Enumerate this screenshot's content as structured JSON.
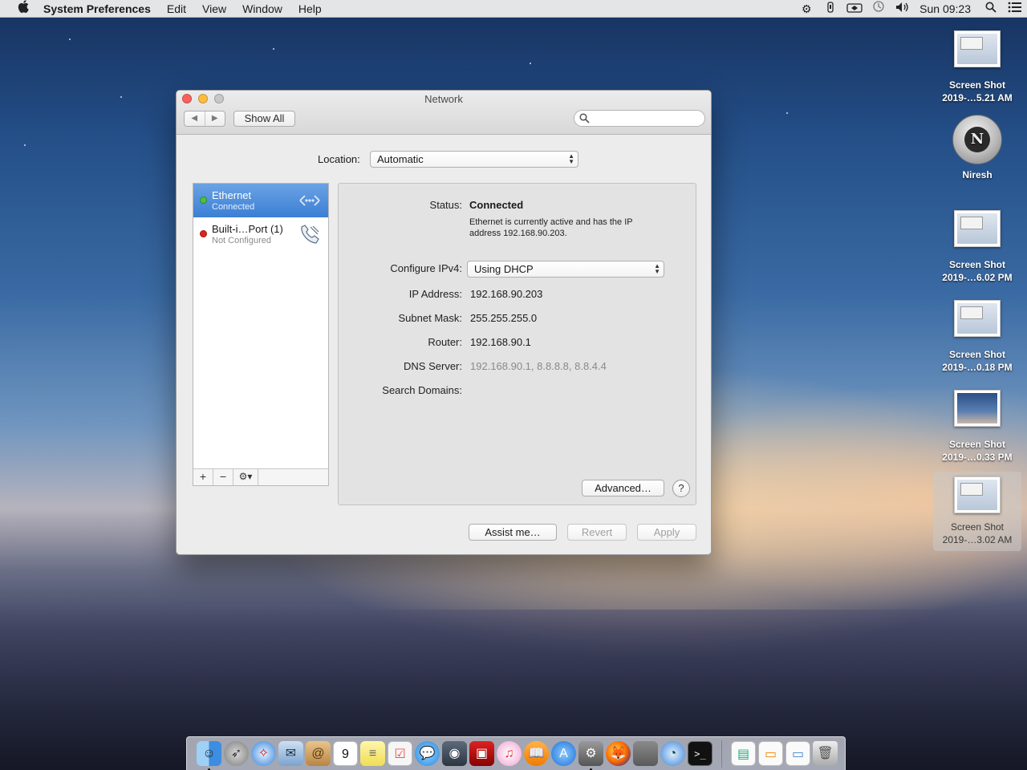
{
  "menubar": {
    "app_name": "System Preferences",
    "items": [
      "Edit",
      "View",
      "Window",
      "Help"
    ],
    "clock": "Sun 09:23"
  },
  "window": {
    "title": "Network",
    "show_all": "Show All",
    "search_placeholder": "",
    "location_label": "Location:",
    "location_value": "Automatic"
  },
  "services": [
    {
      "name": "Ethernet",
      "status": "Connected",
      "state_color": "#4cc43a"
    },
    {
      "name": "Built-i…Port (1)",
      "status": "Not Configured",
      "state_color": "#e0221c"
    }
  ],
  "list_footer": {
    "add": "+",
    "remove": "−",
    "gear": "⚙▾"
  },
  "detail": {
    "status_label": "Status:",
    "status_value": "Connected",
    "status_description": "Ethernet is currently active and has the IP address 192.168.90.203.",
    "configure_label": "Configure IPv4:",
    "configure_value": "Using DHCP",
    "ip_label": "IP Address:",
    "ip_value": "192.168.90.203",
    "subnet_label": "Subnet Mask:",
    "subnet_value": "255.255.255.0",
    "router_label": "Router:",
    "router_value": "192.168.90.1",
    "dns_label": "DNS Server:",
    "dns_value": "192.168.90.1, 8.8.8.8, 8.8.4.4",
    "search_domains_label": "Search Domains:",
    "search_domains_value": "",
    "advanced_button": "Advanced…",
    "help_button": "?"
  },
  "buttons": {
    "assist": "Assist me…",
    "revert": "Revert",
    "apply": "Apply"
  },
  "desktop_icons": [
    {
      "line1": "Screen Shot",
      "line2": "2019-…5.21 AM"
    },
    {
      "line1": "Niresh",
      "line2": ""
    },
    {
      "line1": "Screen Shot",
      "line2": "2019-…6.02 PM"
    },
    {
      "line1": "Screen Shot",
      "line2": "2019-…0.18 PM"
    },
    {
      "line1": "Screen Shot",
      "line2": "2019-…0.33 PM"
    },
    {
      "line1": "Screen Shot",
      "line2": "2019-…3.02 AM"
    }
  ],
  "disk_letter": "N",
  "calendar_day": "9",
  "dock_apps": [
    "finder",
    "launchpad",
    "safari",
    "mail",
    "contacts",
    "calendar",
    "notes",
    "reminders",
    "messages",
    "facetime",
    "photo-booth",
    "itunes",
    "ibooks",
    "app-store",
    "system-preferences",
    "firefox",
    "unknown-app",
    "network-utility",
    "terminal",
    "document",
    "preview-image",
    "mail-attachment",
    "trash"
  ]
}
